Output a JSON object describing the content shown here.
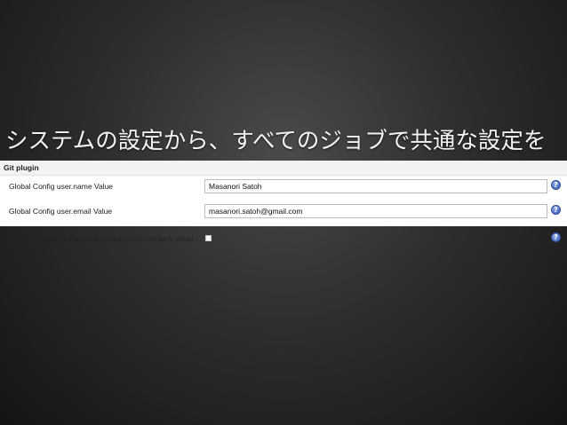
{
  "slide": {
    "title": "システムの設定から、すべてのジョブで共通な設定を"
  },
  "git_plugin": {
    "section_title": "Git plugin",
    "user_name": {
      "label": "Global Config user.name Value",
      "value": "Masanori Satoh"
    },
    "user_email": {
      "label": "Global Config user.email Value",
      "value": "masanori.satoh@gmail.com"
    },
    "create_accounts": {
      "label": "Create new accounts base on author/committer's email",
      "checked": false
    },
    "help_icon_glyph": "?"
  },
  "colors": {
    "help_icon": "#3a5fb8",
    "panel_background": "#ffffff",
    "slide_background": "#2e2e2e"
  }
}
